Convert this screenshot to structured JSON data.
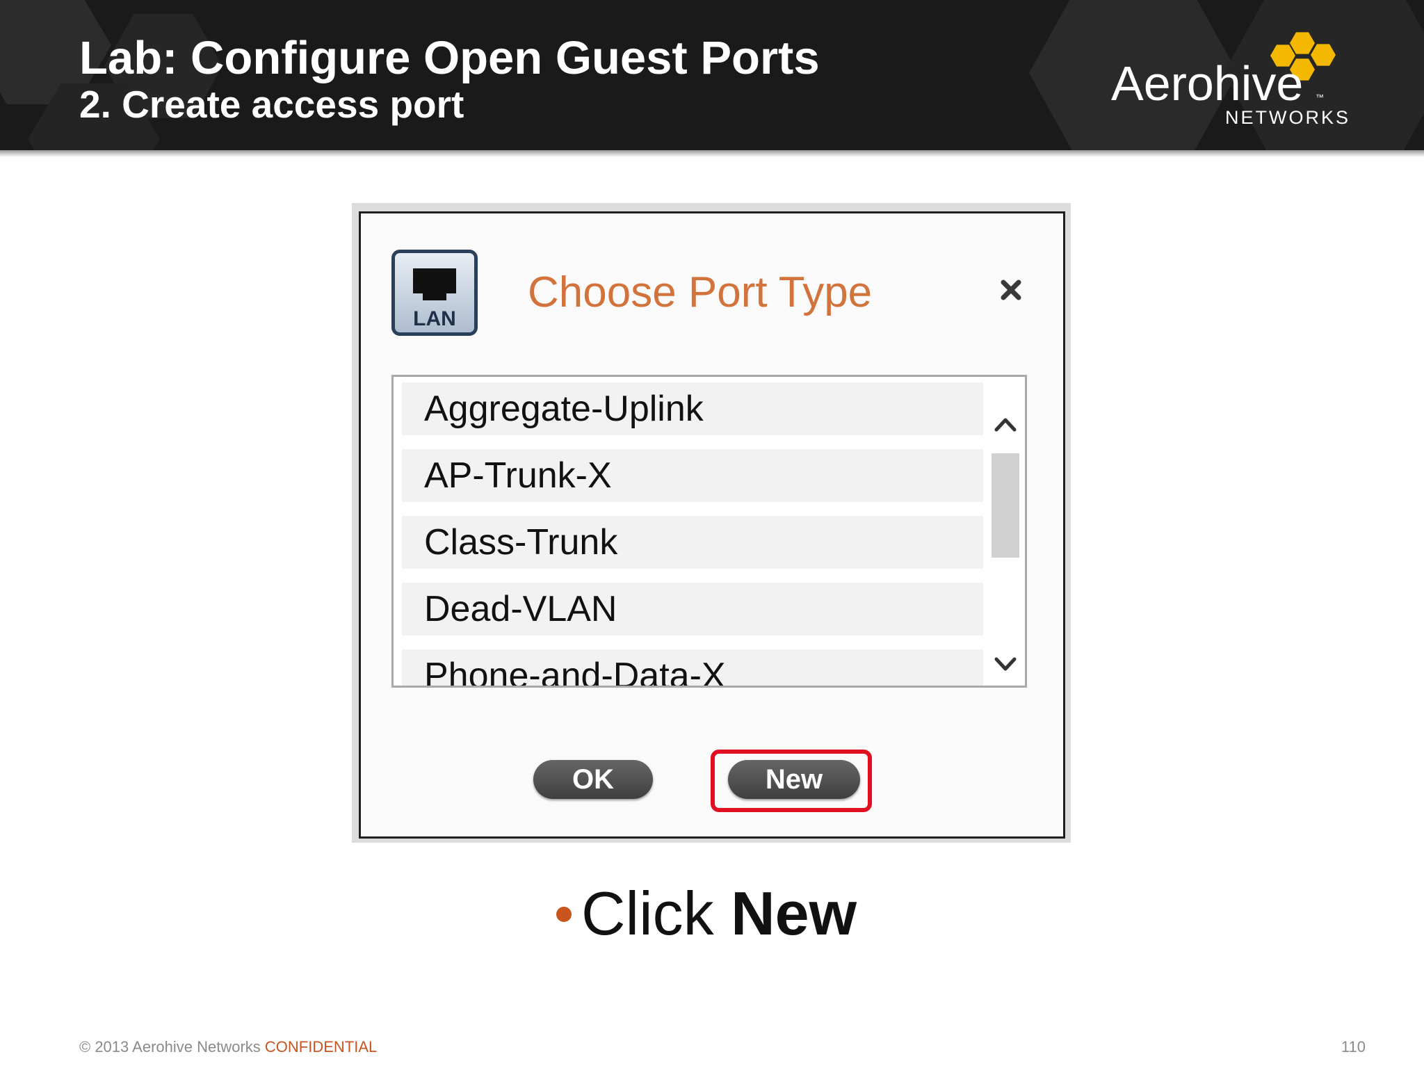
{
  "slide": {
    "title": "Lab: Configure Open Guest Ports",
    "subtitle": "2. Create access port",
    "logo": {
      "name": "Aerohive",
      "tm": "™",
      "tagline": "NETWORKS",
      "hex_color": "#f5b800"
    }
  },
  "dialog": {
    "icon_label": "LAN",
    "title": "Choose Port Type",
    "close_icon": "close-icon",
    "list_items": [
      "Aggregate-Uplink",
      "AP-Trunk-X",
      "Class-Trunk",
      "Dead-VLAN",
      "Phone-and-Data-X"
    ],
    "buttons": {
      "ok": "OK",
      "new": "New"
    },
    "highlight_color": "#e01020",
    "title_color": "#d2733b"
  },
  "instruction": {
    "prefix": "Click",
    "bold": "New"
  },
  "footer": {
    "copyright": "© 2013 Aerohive Networks",
    "confidential": "CONFIDENTIAL",
    "page_number": "110"
  }
}
